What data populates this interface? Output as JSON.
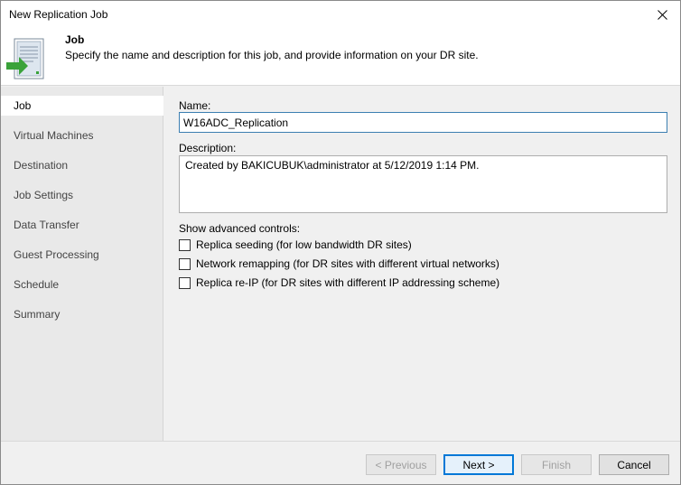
{
  "window": {
    "title": "New Replication Job"
  },
  "header": {
    "title": "Job",
    "description": "Specify the name and description for this job, and provide information on your DR site.",
    "icon": "replication-job-icon"
  },
  "sidebar": {
    "items": [
      {
        "label": "Job",
        "active": true
      },
      {
        "label": "Virtual Machines",
        "active": false
      },
      {
        "label": "Destination",
        "active": false
      },
      {
        "label": "Job Settings",
        "active": false
      },
      {
        "label": "Data Transfer",
        "active": false
      },
      {
        "label": "Guest Processing",
        "active": false
      },
      {
        "label": "Schedule",
        "active": false
      },
      {
        "label": "Summary",
        "active": false
      }
    ]
  },
  "form": {
    "name_label": "Name:",
    "name_value": "W16ADC_Replication",
    "description_label": "Description:",
    "description_value": "Created by BAKICUBUK\\administrator at 5/12/2019 1:14 PM.",
    "advanced_label": "Show advanced controls:",
    "options": [
      {
        "label": "Replica seeding (for low bandwidth DR sites)",
        "checked": false
      },
      {
        "label": "Network remapping (for DR sites with different virtual networks)",
        "checked": false
      },
      {
        "label": "Replica re-IP (for DR sites with different IP addressing scheme)",
        "checked": false
      }
    ]
  },
  "footer": {
    "previous_label": "< Previous",
    "next_label": "Next >",
    "finish_label": "Finish",
    "cancel_label": "Cancel"
  },
  "colors": {
    "accent": "#0078d7",
    "icon_green": "#3aa23a"
  }
}
